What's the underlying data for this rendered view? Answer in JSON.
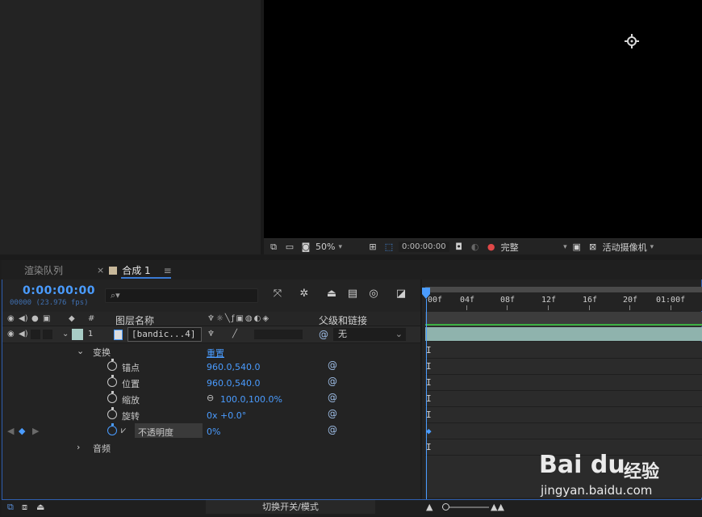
{
  "viewer": {
    "zoom": "50%",
    "timecode": "0:00:00:00",
    "resolution": "完整",
    "camera": "活动摄像机"
  },
  "tabs": {
    "render_queue": "渲染队列",
    "close_glyph": "×",
    "comp": "合成 1",
    "menu_glyph": "≡"
  },
  "timeline": {
    "current_time": "0:00:00:00",
    "frame_info": "00000 (23.976 fps)",
    "search_placeholder": "⌕▾",
    "columns": {
      "hash": "#",
      "layer_name": "图层名称",
      "parent": "父级和链接"
    },
    "layer": {
      "number": "1",
      "name": "[bandic...4]",
      "parent_value": "无"
    },
    "transform": {
      "label": "变换",
      "reset": "重置",
      "properties": [
        {
          "name": "锚点",
          "value": "960.0,540.0"
        },
        {
          "name": "位置",
          "value": "960.0,540.0"
        },
        {
          "name": "缩放",
          "value": "100.0,100.0%"
        },
        {
          "name": "旋转",
          "value": "0x +0.0°"
        },
        {
          "name": "不透明度",
          "value": "0%"
        }
      ]
    },
    "audio_label": "音频",
    "ruler_ticks": [
      "00f",
      "04f",
      "08f",
      "12f",
      "16f",
      "20f",
      "01:00f"
    ],
    "toggle_label": "切换开关/模式"
  },
  "watermark": {
    "logo": "Bai du",
    "text": "经验",
    "url": "jingyan.baidu.com"
  },
  "colors": {
    "accent": "#4a9cff",
    "layer_bar": "#8fb3ad",
    "layer_label": "#a8cdc6",
    "green": "#3cb043"
  }
}
